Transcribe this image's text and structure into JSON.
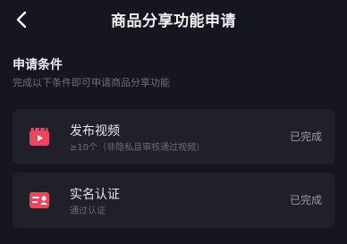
{
  "header": {
    "title": "商品分享功能申请",
    "back_icon": "back-arrow-icon"
  },
  "section": {
    "title": "申请条件",
    "subtitle": "完成以下条件即可申请商品分享功能"
  },
  "conditions": [
    {
      "icon": "video-clapper-icon",
      "title": "发布视频",
      "description": "≥10个（非隐私且审核通过视频）",
      "status": "已完成"
    },
    {
      "icon": "id-card-icon",
      "title": "实名认证",
      "description": "通过认证",
      "status": "已完成"
    }
  ],
  "colors": {
    "background": "#161620",
    "card": "#20202a",
    "icon_accent": "#f0445c"
  }
}
